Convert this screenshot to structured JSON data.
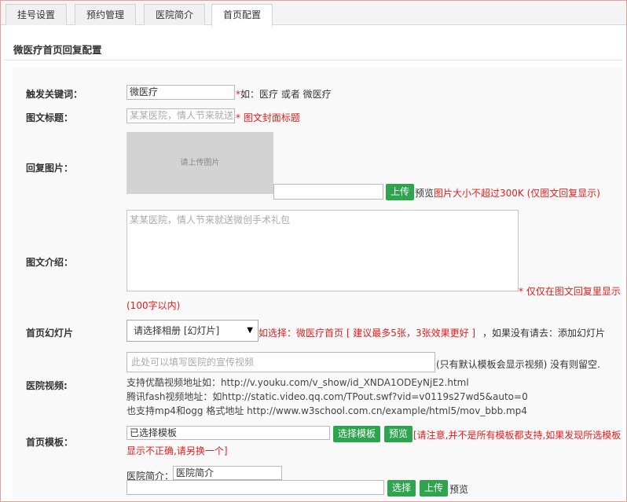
{
  "tabs": [
    {
      "label": "挂号设置",
      "active": false
    },
    {
      "label": "预约管理",
      "active": false
    },
    {
      "label": "医院简介",
      "active": false
    },
    {
      "label": "首页配置",
      "active": true
    }
  ],
  "section_title": "微医疗首页回复配置",
  "trigger": {
    "label": "触发关键词：",
    "value": "微医疗",
    "hint": "*如：医疗 或者 微医疗"
  },
  "article_title": {
    "label": "图文标题：",
    "placeholder": "某某医院，情人节来就送",
    "hint": "* 图文封面标题"
  },
  "reply_image": {
    "label": "回复图片：",
    "placeholder_text": "请上传图片",
    "path_value": "",
    "upload_button": "上传",
    "preview_text": "预览",
    "hint": "图片大小不超过300K (仅图文回复显示)"
  },
  "article_intro": {
    "label": "图文介绍：",
    "placeholder": "某某医院，情人节来就送微创手术礼包",
    "hint": "* 仅仅在图文回复里显示",
    "limit_note": "(100字以内)"
  },
  "slideshow": {
    "label": "首页幻灯片",
    "selected": "请选择相册 [幻灯片]",
    "hint_red": "如选择：微医疗首页 [ 建议最多5张，3张效果更好 ]",
    "hint_dark": "，如果没有请去：添加幻灯片"
  },
  "video": {
    "label": "医院视频:",
    "placeholder": "此处可以填写医院的宣传视频",
    "hint": "(只有默认模板会显示视频) 没有则留空.",
    "line1": "支持优酷视频地址如：http://v.youku.com/v_show/id_XNDA1ODEyNjE2.html",
    "line2": "腾讯fash视频地址：如http://static.video.qq.com/TPout.swf?vid=v0119s27wd5&auto=0",
    "line3": "也支持mp4和ogg 格式地址 http://www.w3school.com.cn/example/html5/mov_bbb.mp4"
  },
  "template": {
    "label": "首页模板：",
    "value": "已选择模板",
    "select_button": "选择模板",
    "preview_button": "预览",
    "hint_line1": "[请注意,并不是所有模板都支持,如果发现所选模板",
    "hint_line2": "显示不正确,请另换一个]"
  },
  "intro_item": {
    "label": "医院简介：",
    "value": "医院简介",
    "path_value": "",
    "select_button": "选择",
    "upload_button": "上传",
    "preview_text": "预览"
  },
  "colors": {
    "accent_green": "#2ea44f",
    "hint_red": "#e02020"
  }
}
